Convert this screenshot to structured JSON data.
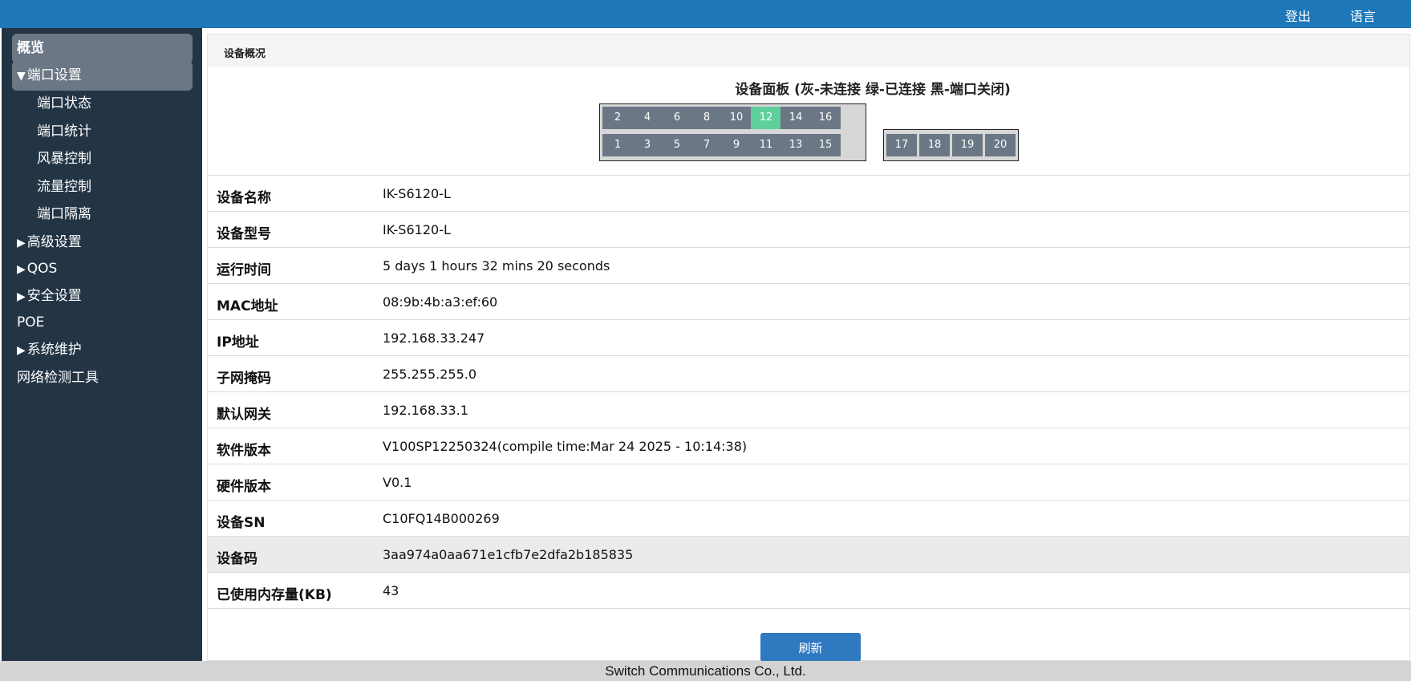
{
  "topbar": {
    "logout": "登出",
    "language": "语言"
  },
  "sidebar": {
    "items": [
      {
        "label": "概览",
        "arrow": ""
      },
      {
        "label": "端口设置",
        "arrow": "▼"
      },
      {
        "label": "端口状态",
        "arrow": ""
      },
      {
        "label": "端口统计",
        "arrow": ""
      },
      {
        "label": "风暴控制",
        "arrow": ""
      },
      {
        "label": "流量控制",
        "arrow": ""
      },
      {
        "label": "端口隔离",
        "arrow": ""
      },
      {
        "label": "高级设置",
        "arrow": "▶"
      },
      {
        "label": "QOS",
        "arrow": "▶"
      },
      {
        "label": "安全设置",
        "arrow": "▶"
      },
      {
        "label": "POE",
        "arrow": ""
      },
      {
        "label": "系统维护",
        "arrow": "▶"
      },
      {
        "label": "网络检测工具",
        "arrow": ""
      }
    ]
  },
  "main": {
    "title": "设备概况",
    "panel_title": "设备面板 (灰-未连接 绿-已连接 黑-端口关闭)",
    "ports": {
      "top_row": [
        "2",
        "4",
        "6",
        "8",
        "10",
        "12",
        "14",
        "16"
      ],
      "bottom_row": [
        "1",
        "3",
        "5",
        "7",
        "9",
        "11",
        "13",
        "15"
      ],
      "extra": [
        "17",
        "18",
        "19",
        "20"
      ],
      "connected": [
        "12"
      ]
    },
    "info": [
      {
        "label": "设备名称",
        "value": "IK-S6120-L"
      },
      {
        "label": "设备型号",
        "value": "IK-S6120-L"
      },
      {
        "label": "运行时间",
        "value": "5 days 1 hours 32 mins 20 seconds"
      },
      {
        "label": "MAC地址",
        "value": "08:9b:4b:a3:ef:60"
      },
      {
        "label": "IP地址",
        "value": "192.168.33.247"
      },
      {
        "label": "子网掩码",
        "value": "255.255.255.0"
      },
      {
        "label": "默认网关",
        "value": "192.168.33.1"
      },
      {
        "label": "软件版本",
        "value": "V100SP12250324(compile time:Mar 24 2025 - 10:14:38)"
      },
      {
        "label": "硬件版本",
        "value": "V0.1"
      },
      {
        "label": "设备SN",
        "value": "C10FQ14B000269"
      },
      {
        "label": "设备码",
        "value": "3aa974a0aa671e1cfb7e2dfa2b185835"
      },
      {
        "label": "已使用内存量(KB)",
        "value": "43"
      }
    ],
    "refresh_label": "刷新"
  },
  "footer": {
    "text": "Switch Communications Co., Ltd."
  },
  "colors": {
    "topbar": "#1e77b8",
    "sidebar": "#233445",
    "port_idle": "#6b7785",
    "port_connected": "#5fcf9b",
    "button": "#2e79c0"
  }
}
